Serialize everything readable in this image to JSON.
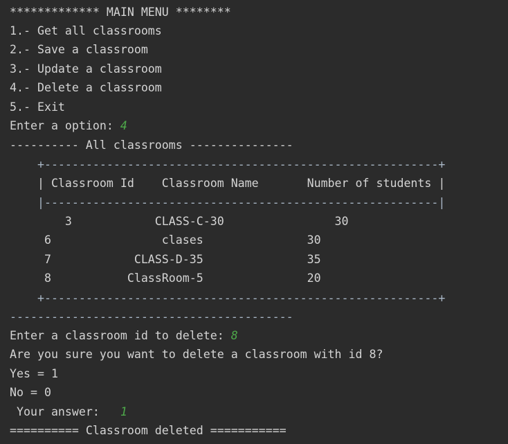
{
  "console": {
    "menu": {
      "header": "************* MAIN MENU ********",
      "items": [
        "1.- Get all classrooms",
        "2.- Save a classroom",
        "3.- Update a classroom",
        "4.- Delete a classroom",
        "5.- Exit"
      ],
      "prompt": "Enter a option: ",
      "input": "4"
    },
    "listing": {
      "title": "---------- All classrooms ---------------",
      "border_top": "    +---------------------------------------------------------+",
      "header_row": "    | Classroom Id    Classroom Name       Number of students |",
      "header_sep": "    |---------------------------------------------------------|",
      "rows": [
        "        3            CLASS-C-30                30",
        "     6                clases               30",
        "     7            CLASS-D-35               35",
        "     8           ClassRoom-5               20"
      ],
      "border_bottom": "    +---------------------------------------------------------+",
      "footer": "-----------------------------------------"
    },
    "delete": {
      "prompt": "Enter a classroom id to delete: ",
      "input": "8",
      "confirm": "Are you sure you want to delete a classroom with id 8?",
      "yes": "Yes = 1",
      "no": "No = 0",
      "answer_prompt": " Your answer:   ",
      "answer_input": "1",
      "result": "========== Classroom deleted ==========="
    }
  }
}
